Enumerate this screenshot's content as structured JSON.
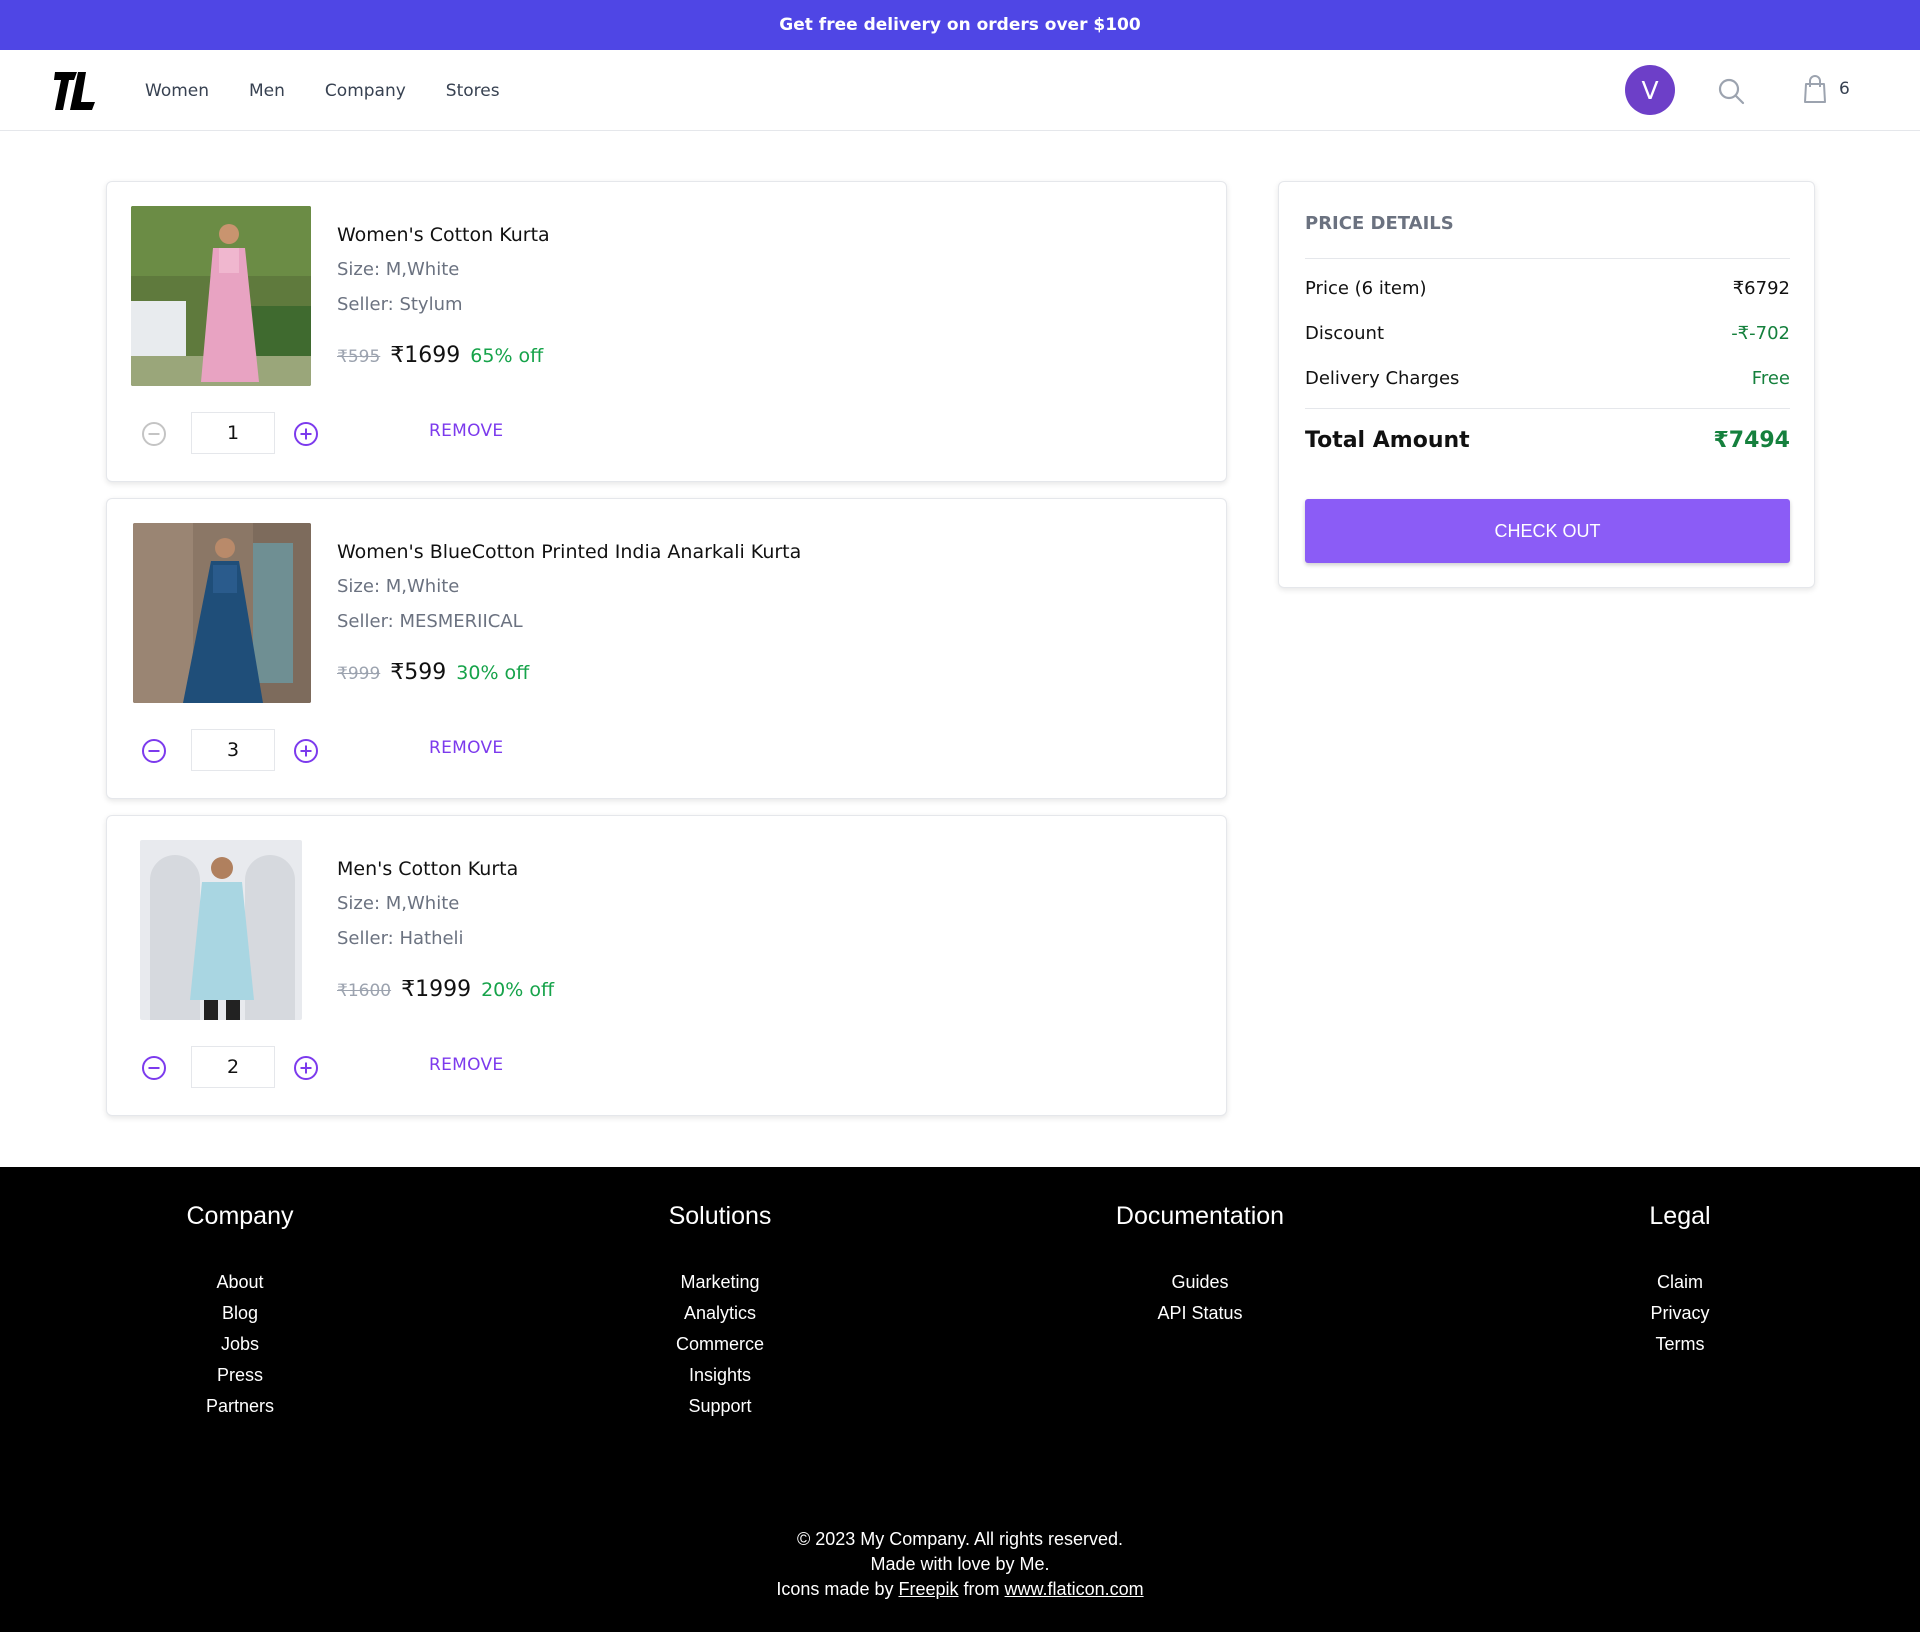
{
  "promo": {
    "text": "Get free delivery on orders over $100"
  },
  "nav": {
    "logo_text": "TL",
    "links": [
      "Women",
      "Men",
      "Company",
      "Stores"
    ],
    "avatar_letter": "V",
    "cart_count": "6"
  },
  "cart": {
    "items": [
      {
        "title": "Women's Cotton Kurta",
        "size": "Size: M,White",
        "seller": "Seller: Stylum",
        "mrp": "₹595",
        "price": "₹1699",
        "discount": "65% off",
        "qty": "1",
        "remove_label": "REMOVE"
      },
      {
        "title": "Women's BlueCotton Printed India Anarkali Kurta",
        "size": "Size: M,White",
        "seller": "Seller: MESMERIICAL",
        "mrp": "₹999",
        "price": "₹599",
        "discount": "30% off",
        "qty": "3",
        "remove_label": "REMOVE"
      },
      {
        "title": "Men's Cotton Kurta",
        "size": "Size: M,White",
        "seller": "Seller: Hatheli",
        "mrp": "₹1600",
        "price": "₹1999",
        "discount": "20% off",
        "qty": "2",
        "remove_label": "REMOVE"
      }
    ]
  },
  "summary": {
    "heading": "PRICE DETAILS",
    "price_label": "Price (6 item)",
    "price_value": "₹6792",
    "discount_label": "Discount",
    "discount_value": "-₹-702",
    "delivery_label": "Delivery Charges",
    "delivery_value": "Free",
    "total_label": "Total Amount",
    "total_value": "₹7494",
    "checkout_label": "CHECK OUT"
  },
  "footer": {
    "columns": [
      {
        "heading": "Company",
        "links": [
          "About",
          "Blog",
          "Jobs",
          "Press",
          "Partners"
        ]
      },
      {
        "heading": "Solutions",
        "links": [
          "Marketing",
          "Analytics",
          "Commerce",
          "Insights",
          "Support"
        ]
      },
      {
        "heading": "Documentation",
        "links": [
          "Guides",
          "API Status"
        ]
      },
      {
        "heading": "Legal",
        "links": [
          "Claim",
          "Privacy",
          "Terms"
        ]
      }
    ],
    "copyright": "© 2023 My Company. All rights reserved.",
    "made_with": "Made with love by Me.",
    "icons_prefix": "Icons made by",
    "icons_author": "Freepik",
    "icons_from": "from",
    "icons_site": "www.flaticon.com"
  },
  "colors": {
    "brand": "#4f46e5",
    "accent": "#8b5cf6",
    "success": "#15803d"
  }
}
